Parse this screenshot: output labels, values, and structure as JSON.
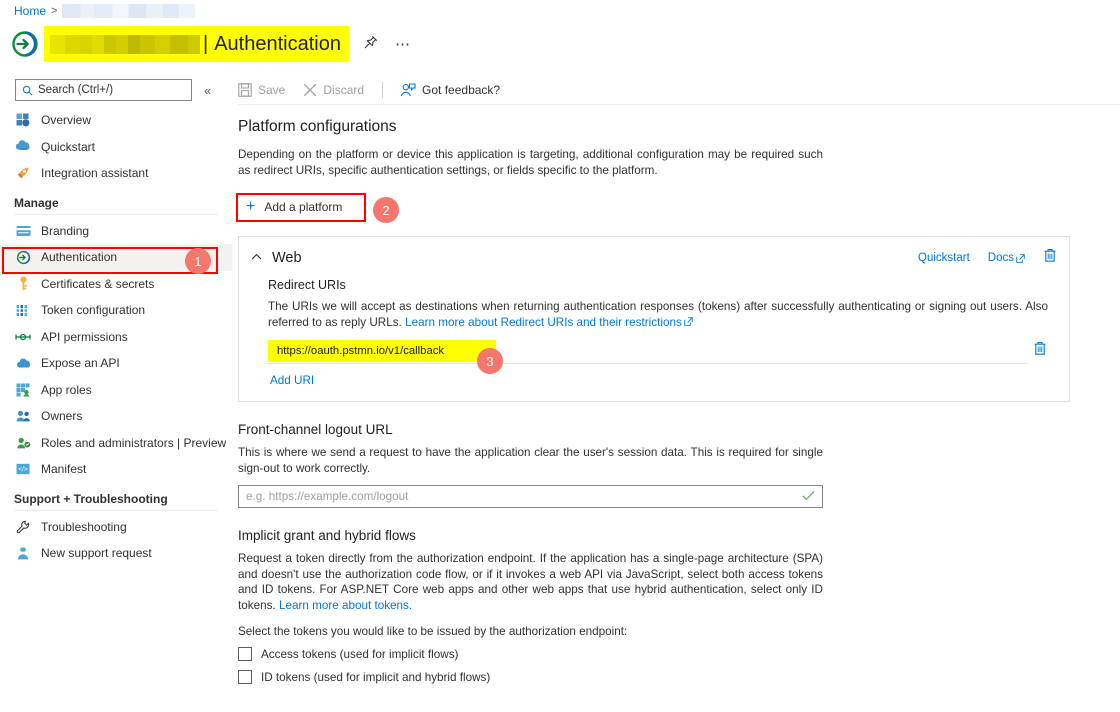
{
  "breadcrumb": {
    "home": "Home",
    "separator": ">",
    "redacted_app": ""
  },
  "header": {
    "app_name_redacted": "",
    "separator": "|",
    "page_title": "Authentication",
    "pin_icon": "pin-icon",
    "more_icon": "ellipsis-icon",
    "highlight_color": "#ffff00"
  },
  "sidebar": {
    "search": {
      "placeholder": "Search (Ctrl+/)",
      "value": "",
      "icon": "search-icon"
    },
    "collapse_label": "«",
    "items": [
      {
        "label": "Overview",
        "icon": "overview-icon"
      },
      {
        "label": "Quickstart",
        "icon": "quickstart-icon"
      },
      {
        "label": "Integration assistant",
        "icon": "rocket-icon"
      }
    ],
    "groups": [
      {
        "title": "Manage",
        "items": [
          {
            "label": "Branding",
            "icon": "branding-icon"
          },
          {
            "label": "Authentication",
            "icon": "authentication-icon",
            "selected": true
          },
          {
            "label": "Certificates & secrets",
            "icon": "key-icon"
          },
          {
            "label": "Token configuration",
            "icon": "token-icon"
          },
          {
            "label": "API permissions",
            "icon": "api-permissions-icon"
          },
          {
            "label": "Expose an API",
            "icon": "cloud-icon"
          },
          {
            "label": "App roles",
            "icon": "app-roles-icon"
          },
          {
            "label": "Owners",
            "icon": "owners-icon"
          },
          {
            "label": "Roles and administrators | Preview",
            "icon": "roles-admins-icon"
          },
          {
            "label": "Manifest",
            "icon": "manifest-icon"
          }
        ]
      },
      {
        "title": "Support + Troubleshooting",
        "items": [
          {
            "label": "Troubleshooting",
            "icon": "wrench-icon"
          },
          {
            "label": "New support request",
            "icon": "support-person-icon"
          }
        ]
      }
    ]
  },
  "toolbar": {
    "save_label": "Save",
    "save_icon": "save-disk-icon",
    "discard_label": "Discard",
    "discard_icon": "x-icon",
    "feedback_label": "Got feedback?",
    "feedback_icon": "feedback-person-icon"
  },
  "main": {
    "platform_configurations": {
      "heading": "Platform configurations",
      "description": "Depending on the platform or device this application is targeting, additional configuration may be required such as redirect URIs, specific authentication settings, or fields specific to the platform.",
      "add_platform_label": "Add a platform",
      "add_platform_icon": "plus-icon"
    },
    "web_card": {
      "title": "Web",
      "collapse_icon": "chevron-up-icon",
      "quickstart_link": "Quickstart",
      "docs_link": "Docs",
      "docs_external_icon": "external-link-icon",
      "delete_icon": "trash-icon",
      "redirect_uris": {
        "heading": "Redirect URIs",
        "description_part1": "The URIs we will accept as destinations when returning authentication responses (tokens) after successfully authenticating or signing out users. Also referred to as reply URLs. ",
        "learn_more_link": "Learn more about Redirect URIs and their restrictions",
        "uri_value": "https://oauth.pstmn.io/v1/callback",
        "uri_delete_icon": "trash-icon",
        "add_uri_label": "Add URI",
        "highlight_color": "#ffff00"
      }
    },
    "front_channel_logout": {
      "heading": "Front-channel logout URL",
      "description": "This is where we send a request to have the application clear the user's session data. This is required for single sign-out to work correctly.",
      "input_placeholder": "e.g. https://example.com/logout",
      "input_value": "",
      "valid_icon": "checkmark-icon"
    },
    "implicit_grant": {
      "heading": "Implicit grant and hybrid flows",
      "description_part1": "Request a token directly from the authorization endpoint. If the application has a single-page architecture (SPA) and doesn't use the authorization code flow, or if it invokes a web API via JavaScript, select both access tokens and ID tokens. For ASP.NET Core web apps and other web apps that use hybrid authentication, select only ID tokens. ",
      "learn_more_link": "Learn more about tokens.",
      "select_label": "Select the tokens you would like to be issued by the authorization endpoint:",
      "checkboxes": [
        {
          "label": "Access tokens (used for implicit flows)",
          "checked": false
        },
        {
          "label": "ID tokens (used for implicit and hybrid flows)",
          "checked": false
        }
      ]
    }
  },
  "annotations": {
    "marker_color": "#f4766c",
    "callout_border_color": "#ff0000",
    "markers": [
      {
        "number": "1",
        "target": "sidebar-item-authentication"
      },
      {
        "number": "2",
        "target": "add-platform-button"
      },
      {
        "number": "3",
        "target": "redirect-uri-input"
      }
    ]
  }
}
